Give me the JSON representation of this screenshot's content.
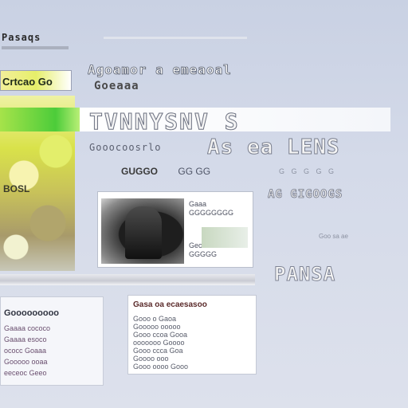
{
  "site": {
    "logo": "Pasaqs",
    "badge": "Crtcao Go"
  },
  "nav": {
    "headline": "Agoamor a emeaoal",
    "subhead": "Goeaaa"
  },
  "banner": {
    "title": "TVNNYSNV S",
    "side_caption": "BOSL"
  },
  "intro": {
    "tagline": "Gooocoosrlo",
    "tagline_big": "As ea LENS",
    "meta_primary": "GUGGO",
    "meta_secondary": "GG GG",
    "meta_faint": "G G G G G"
  },
  "card": {
    "text_lines": [
      "Gaaa",
      "GGGGGGGG",
      "Geco",
      "GGGGG"
    ]
  },
  "right_column": {
    "title": "AG GIGOOGS",
    "small": "Goo sa ae",
    "big": "PANSA"
  },
  "list": {
    "title": "Gooooooooo",
    "lines": [
      "Gaaaa cococo",
      "Gaaaa esoco",
      "ococc Goaaa",
      "Gooooo ooaa",
      "eeceoc Geeo"
    ]
  },
  "table": {
    "header": "Gasa oa ecaesasoo",
    "lines": [
      "Gooo o Gaoa",
      "Gooooo ooooo",
      "Gooo ccoa Gooa",
      "ooooooo Goooo",
      "Gooo ccca Goa",
      "Goooo ooo",
      "Gooo oooo Gooo"
    ]
  },
  "colors": {
    "banner_green": "#4ccc3a",
    "panel_yellow": "#d9e24a",
    "background": "#cfd6e6"
  }
}
